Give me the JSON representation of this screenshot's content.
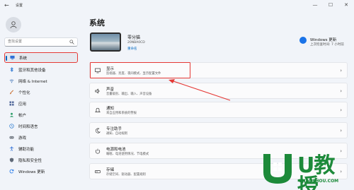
{
  "window": {
    "title": "设置"
  },
  "sidebar": {
    "search_placeholder": "查找设置",
    "items": [
      {
        "label": "系统",
        "icon": "monitor-icon",
        "active": true
      },
      {
        "label": "蓝牙和其他设备",
        "icon": "bluetooth-icon",
        "active": false
      },
      {
        "label": "网络 & Internet",
        "icon": "wifi-icon",
        "active": false
      },
      {
        "label": "个性化",
        "icon": "brush-icon",
        "active": false
      },
      {
        "label": "应用",
        "icon": "apps-icon",
        "active": false
      },
      {
        "label": "帐户",
        "icon": "person-icon",
        "active": false
      },
      {
        "label": "时间和语言",
        "icon": "globe-clock-icon",
        "active": false
      },
      {
        "label": "游戏",
        "icon": "gamepad-icon",
        "active": false
      },
      {
        "label": "辅助功能",
        "icon": "accessibility-icon",
        "active": false
      },
      {
        "label": "隐私和安全性",
        "icon": "shield-icon",
        "active": false
      },
      {
        "label": "Windows 更新",
        "icon": "update-icon",
        "active": false
      }
    ]
  },
  "main": {
    "title": "系统",
    "device": {
      "name": "零分猫",
      "model": "20NBA0CD",
      "rename": "重命名"
    },
    "windows_update": {
      "title": "Windows 更新",
      "subtitle": "上次检查时间: 7 小时前"
    },
    "cards": [
      {
        "title": "显示",
        "subtitle": "监视器、亮度、夜间模式、显示配置文件",
        "icon": "display-icon"
      },
      {
        "title": "声音",
        "subtitle": "音量级别、输出、输入、声音设备",
        "icon": "speaker-icon"
      },
      {
        "title": "通知",
        "subtitle": "来自应用和系统的警报",
        "icon": "bell-icon"
      },
      {
        "title": "专注助手",
        "subtitle": "通知、自动规则",
        "icon": "moon-icon"
      },
      {
        "title": "电源和电池",
        "subtitle": "睡眠、电池使用情况、节电模式",
        "icon": "power-icon"
      },
      {
        "title": "存储",
        "subtitle": "存储空间、驱动器、配置规则",
        "icon": "storage-icon"
      }
    ]
  },
  "watermark": {
    "brand": "U教授",
    "url": "UJIAOSHOU.COM"
  },
  "colors": {
    "accent": "#0067c0",
    "highlight": "#e53935",
    "brand_green": "#1d8a3a"
  }
}
